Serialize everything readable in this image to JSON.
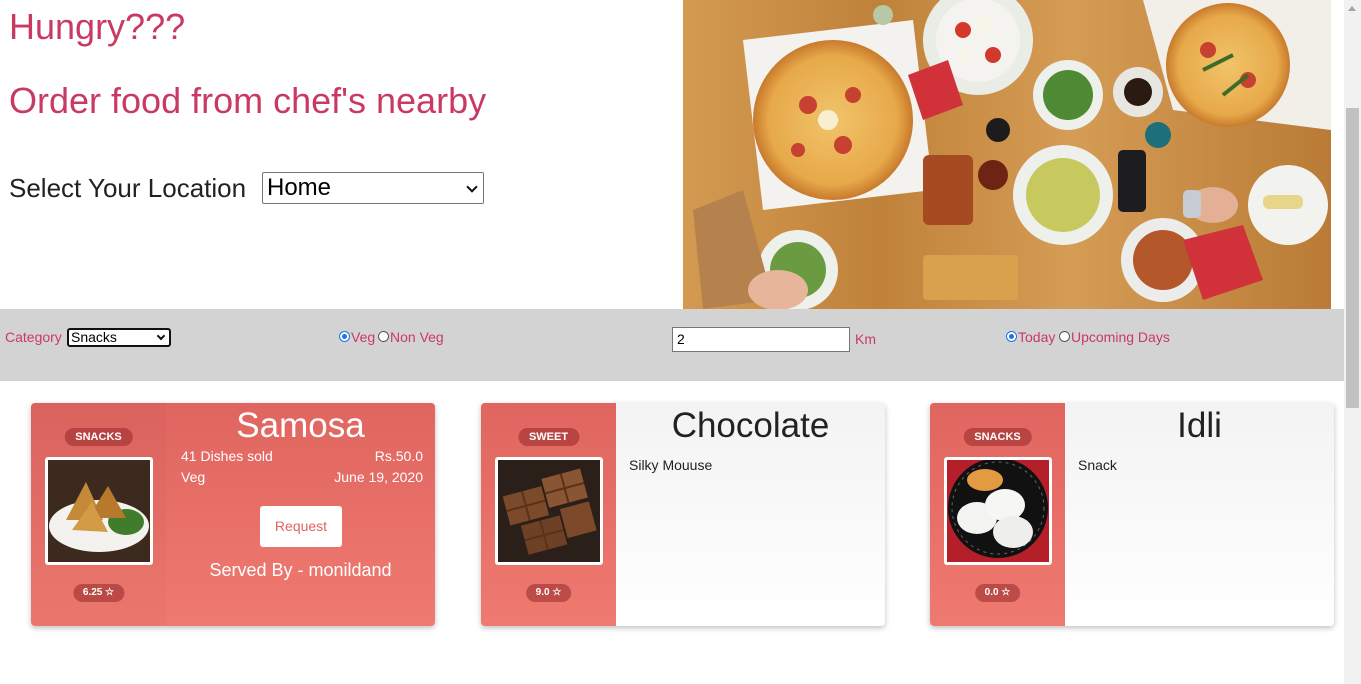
{
  "hero": {
    "title": "Hungry???",
    "subtitle": "Order food from chef's nearby",
    "location_label": "Select Your Location",
    "location_value": "Home"
  },
  "filters": {
    "category_label": "Category",
    "category_value": "Snacks",
    "veg_label": "Veg",
    "nonveg_label": "Non Veg",
    "veg_selected": true,
    "distance_value": "2",
    "distance_unit": "Km",
    "today_label": "Today",
    "upcoming_label": "Upcoming Days",
    "today_selected": true
  },
  "cards": [
    {
      "badge": "SNACKS",
      "title": "Samosa",
      "dishes_sold": "41 Dishes sold",
      "price": "Rs.50.0",
      "type": "Veg",
      "date": "June 19, 2020",
      "request_label": "Request",
      "served_by": "Served By - monildand",
      "rating": "6.25 ☆"
    },
    {
      "badge": "SWEET",
      "title": "Chocolate",
      "description": "Silky Mouuse",
      "rating": "9.0 ☆"
    },
    {
      "badge": "SNACKS",
      "title": "Idli",
      "description": "Snack",
      "rating": "0.0 ☆"
    }
  ],
  "colors": {
    "accent": "#c93a63",
    "card_red": "#e8706a",
    "filter_bar": "#d3d3d3"
  }
}
